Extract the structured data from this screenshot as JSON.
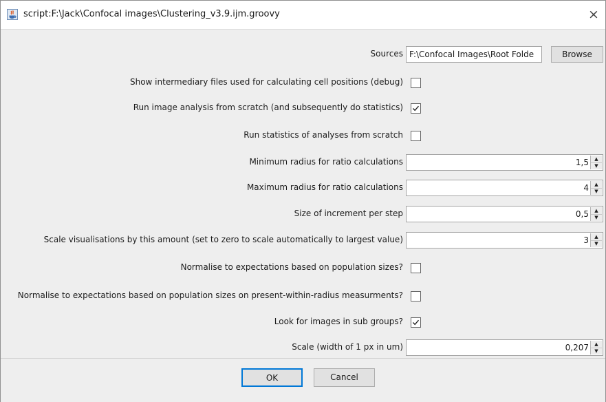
{
  "window": {
    "title": "script:F:\\Jack\\Confocal images\\Clustering_v3.9.ijm.groovy",
    "close_glyph": "×",
    "icon": "java-app-icon"
  },
  "sources": {
    "label": "Sources",
    "value": "F:\\Confocal Images\\Root Folde",
    "browse_label": "Browse"
  },
  "options": [
    {
      "label": "Show intermediary files used for calculating cell positions (debug)",
      "type": "checkbox",
      "checked": false
    },
    {
      "label": "Run image analysis from scratch (and subsequently do statistics)",
      "type": "checkbox",
      "checked": true
    },
    {
      "label": "Run statistics of analyses from scratch",
      "type": "checkbox",
      "checked": false
    },
    {
      "label": "Minimum radius for ratio calculations",
      "type": "spinner",
      "value": "1,5"
    },
    {
      "label": "Maximum radius for ratio calculations",
      "type": "spinner",
      "value": "4"
    },
    {
      "label": "Size of increment per step",
      "type": "spinner",
      "value": "0,5"
    },
    {
      "label": "Scale visualisations by this amount (set to zero to scale automatically to largest value)",
      "type": "spinner",
      "value": "3"
    },
    {
      "label": "Normalise to expectations based on population sizes?",
      "type": "checkbox",
      "checked": false
    },
    {
      "label": "Normalise to expectations based on population sizes on present-within-radius measurments?",
      "type": "checkbox",
      "checked": false
    },
    {
      "label": "Look for images in sub groups?",
      "type": "checkbox",
      "checked": true
    },
    {
      "label": "Scale (width of 1 px in um)",
      "type": "spinner",
      "value": "0,207"
    }
  ],
  "buttons": {
    "ok_label": "OK",
    "cancel_label": "Cancel"
  },
  "colors": {
    "focus_border": "#0078d7",
    "dialog_background": "#eeeeee"
  }
}
